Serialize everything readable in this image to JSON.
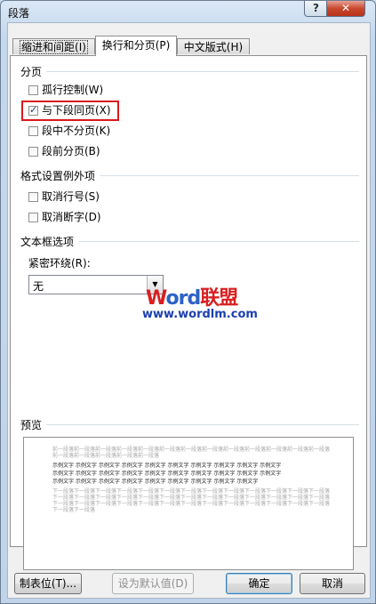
{
  "window": {
    "title": "段落",
    "help_glyph": "?",
    "close_glyph": "✕"
  },
  "tabs": [
    {
      "label": "缩进和间距(I)",
      "active": false
    },
    {
      "label": "换行和分页(P)",
      "active": true
    },
    {
      "label": "中文版式(H)",
      "active": false
    }
  ],
  "pagination": {
    "title": "分页",
    "widow_control": {
      "label": "孤行控制(W)",
      "checked": false
    },
    "keep_with_next": {
      "label": "与下段同页(X)",
      "checked": true
    },
    "keep_lines_together": {
      "label": "段中不分页(K)",
      "checked": false
    },
    "page_break_before": {
      "label": "段前分页(B)",
      "checked": false
    }
  },
  "format_exceptions": {
    "title": "格式设置例外项",
    "suppress_line_numbers": {
      "label": "取消行号(S)",
      "checked": false
    },
    "dont_hyphenate": {
      "label": "取消断字(D)",
      "checked": false
    }
  },
  "textbox_options": {
    "title": "文本框选项",
    "tight_wrap_label": "紧密环绕(R):",
    "tight_wrap_value": "无",
    "dropdown_arrow": "▼"
  },
  "watermark": {
    "logo_w": "W",
    "logo_ord": "ord",
    "logo_cn": "联盟",
    "url": "www.wordlm.com"
  },
  "preview": {
    "title": "预览",
    "prev_paragraph": [
      "前一段落前一段落前一段落前一段落前一段落前一段落前一段落前一段落前一段落前一段落前一段落前一段落前一段落",
      "前一段落前一段落前一段落前一段落前一段落"
    ],
    "sample_paragraph": [
      "示例文字 示例文字 示例文字 示例文字 示例文字 示例文字 示例文字 示例文字 示例文字 示例文字",
      "示例文字 示例文字 示例文字 示例文字 示例文字 示例文字 示例文字 示例文字 示例文字 示例文字",
      "示例文字 示例文字 示例文字 示例文字 示例文字 示例文字 示例文字 示例文字 示例文字"
    ],
    "next_paragraph": [
      "下一段落下一段落下一段落下一段落下一段落下一段落下一段落下一段落下一段落下一段落下一段落下一段落下一段落",
      "下一段落下一段落下一段落下一段落下一段落下一段落下一段落下一段落下一段落下一段落下一段落下一段落下一段落",
      "下一段落下一段落下一段落下一段落下一段落下一段落下一段落下一段落下一段落下一段落下一段落下一段落下一段落",
      "下一段落下一段落"
    ]
  },
  "buttons": {
    "tabs_button": "制表位(T)...",
    "set_default": "设为默认值(D)",
    "ok": "确定",
    "cancel": "取消"
  },
  "colors": {
    "highlight_box": "#d8191c",
    "watermark_red": "#d81f20",
    "watermark_blue": "#2c62c7"
  }
}
